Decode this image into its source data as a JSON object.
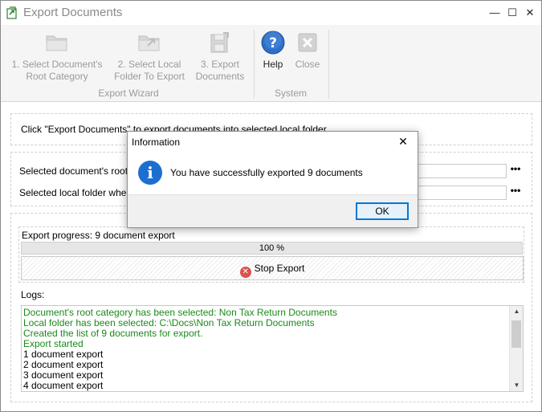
{
  "window": {
    "title": "Export Documents",
    "minimize_glyph": "—",
    "maximize_glyph": "☐",
    "close_glyph": "✕"
  },
  "ribbon": {
    "buttons": [
      {
        "label_line1": "1. Select Document's",
        "label_line2": "Root Category",
        "icon": "folder-icon"
      },
      {
        "label_line1": "2. Select Local",
        "label_line2": "Folder To Export",
        "icon": "folder-arrow-icon"
      },
      {
        "label_line1": "3. Export",
        "label_line2": "Documents",
        "icon": "save-export-icon"
      },
      {
        "label_line1": "Help",
        "icon": "help-icon"
      },
      {
        "label_line1": "Close",
        "icon": "close-icon"
      }
    ],
    "groups": {
      "wizard": "Export Wizard",
      "system": "System"
    }
  },
  "main": {
    "instruction": "Click \"Export Documents\" to export documents into selected local folder",
    "root_category_label": "Selected document's root category:",
    "local_folder_label": "Selected local folder where documents will be exported:",
    "ellipsis": "•••",
    "progress_label": "Export progress: 9 document export",
    "progress_percent": 100,
    "progress_text": "100 %",
    "stop_label": "Stop Export",
    "logs_label": "Logs:",
    "logs": [
      {
        "text": "Document's root category has been selected: Non Tax Return Documents",
        "color": "#1a8a1a"
      },
      {
        "text": "Local folder has been selected: C:\\Docs\\Non Tax Return Documents",
        "color": "#1a8a1a"
      },
      {
        "text": "Created the list of 9 documents for export.",
        "color": "#1a8a1a"
      },
      {
        "text": "Export started",
        "color": "#1a8a1a"
      },
      {
        "text": "1 document export",
        "color": "#000000"
      },
      {
        "text": "2 document export",
        "color": "#000000"
      },
      {
        "text": "3 document export",
        "color": "#000000"
      },
      {
        "text": "4 document export",
        "color": "#000000"
      }
    ]
  },
  "dialog": {
    "title": "Information",
    "message": "You have successfully exported 9 documents",
    "ok_label": "OK",
    "close_glyph": "✕",
    "icon_glyph": "i"
  }
}
